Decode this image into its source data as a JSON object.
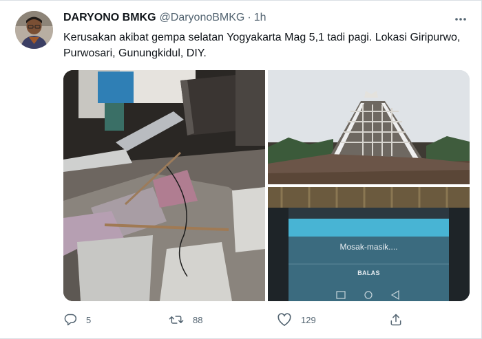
{
  "tweet": {
    "display_name": "DARYONO BMKG",
    "handle": "@DaryonoBMKG",
    "separator": "·",
    "time": "1h",
    "text": "Kerusakan akibat gempa selatan Yogyakarta Mag 5,1 tadi pagi. Lokasi Giripurwo, Purwosari, Gunungkidul, DIY."
  },
  "media": {
    "phone_screen_text": "Mosak-masik....",
    "phone_button_label": "BALAS"
  },
  "actions": {
    "reply_count": "5",
    "retweet_count": "88",
    "like_count": "129"
  },
  "icons": {
    "reply": "speech-bubble-icon",
    "retweet": "retweet-arrows-icon",
    "like": "heart-icon",
    "share": "share-upload-icon",
    "more": "ellipsis-icon"
  },
  "colors": {
    "text_primary": "#0f1419",
    "text_secondary": "#536471",
    "border": "#d9dfe4"
  }
}
